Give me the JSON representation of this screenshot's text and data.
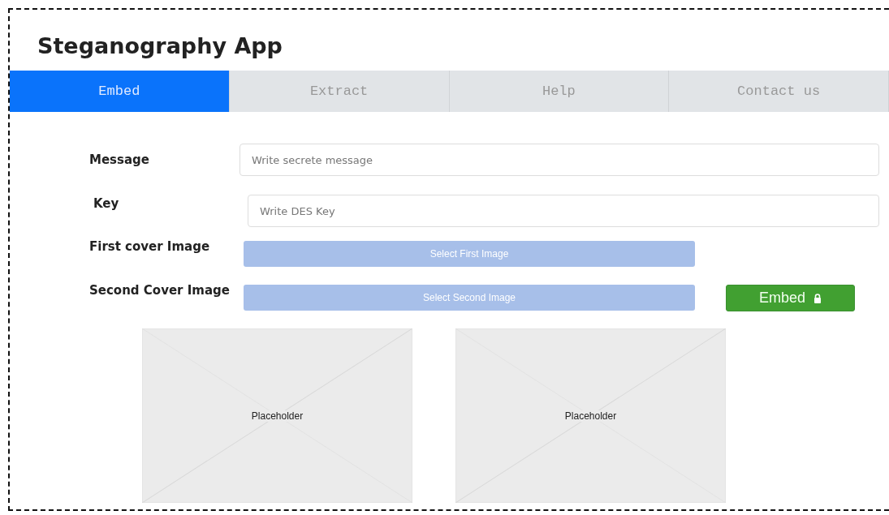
{
  "app": {
    "title": "Steganography App"
  },
  "tabs": [
    {
      "label": "Embed",
      "selected": true
    },
    {
      "label": "Extract",
      "selected": false
    },
    {
      "label": "Help",
      "selected": false
    },
    {
      "label": "Contact us",
      "selected": false
    }
  ],
  "form": {
    "rows": [
      {
        "kind": "text",
        "label": "Message",
        "placeholder": "Write secrete message"
      },
      {
        "kind": "text",
        "label": "Key",
        "placeholder": "Write DES Key"
      },
      {
        "kind": "file",
        "label": "First cover Image",
        "button": "Select First Image"
      },
      {
        "kind": "file",
        "label": "Second Cover Image",
        "button": "Select Second Image"
      }
    ],
    "submit": "Embed"
  },
  "previews": [
    "Placeholder",
    "Placeholder"
  ]
}
